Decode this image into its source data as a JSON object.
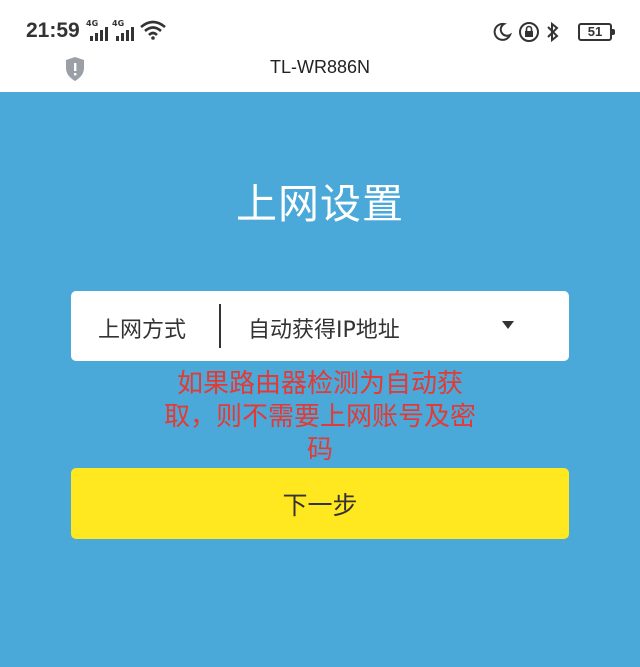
{
  "status_bar": {
    "time": "21:59",
    "signal_1": "4G",
    "signal_2": "4G",
    "battery": "51"
  },
  "title_bar": {
    "url": "TL-WR886N"
  },
  "main": {
    "heading": "上网设置",
    "connection_field": {
      "label": "上网方式",
      "value": "自动获得IP地址"
    },
    "annotation": "如果路由器检测为自动获取，则不需要上网账号及密码",
    "next_button": "下一步"
  },
  "colors": {
    "background": "#4aa9d8",
    "button": "#ffe81f",
    "annotation": "#e53935"
  },
  "icons": [
    "signal-icon",
    "wifi-icon",
    "moon-icon",
    "lock-rotation-icon",
    "bluetooth-icon",
    "battery-icon",
    "shield-icon",
    "chevron-down-icon"
  ]
}
